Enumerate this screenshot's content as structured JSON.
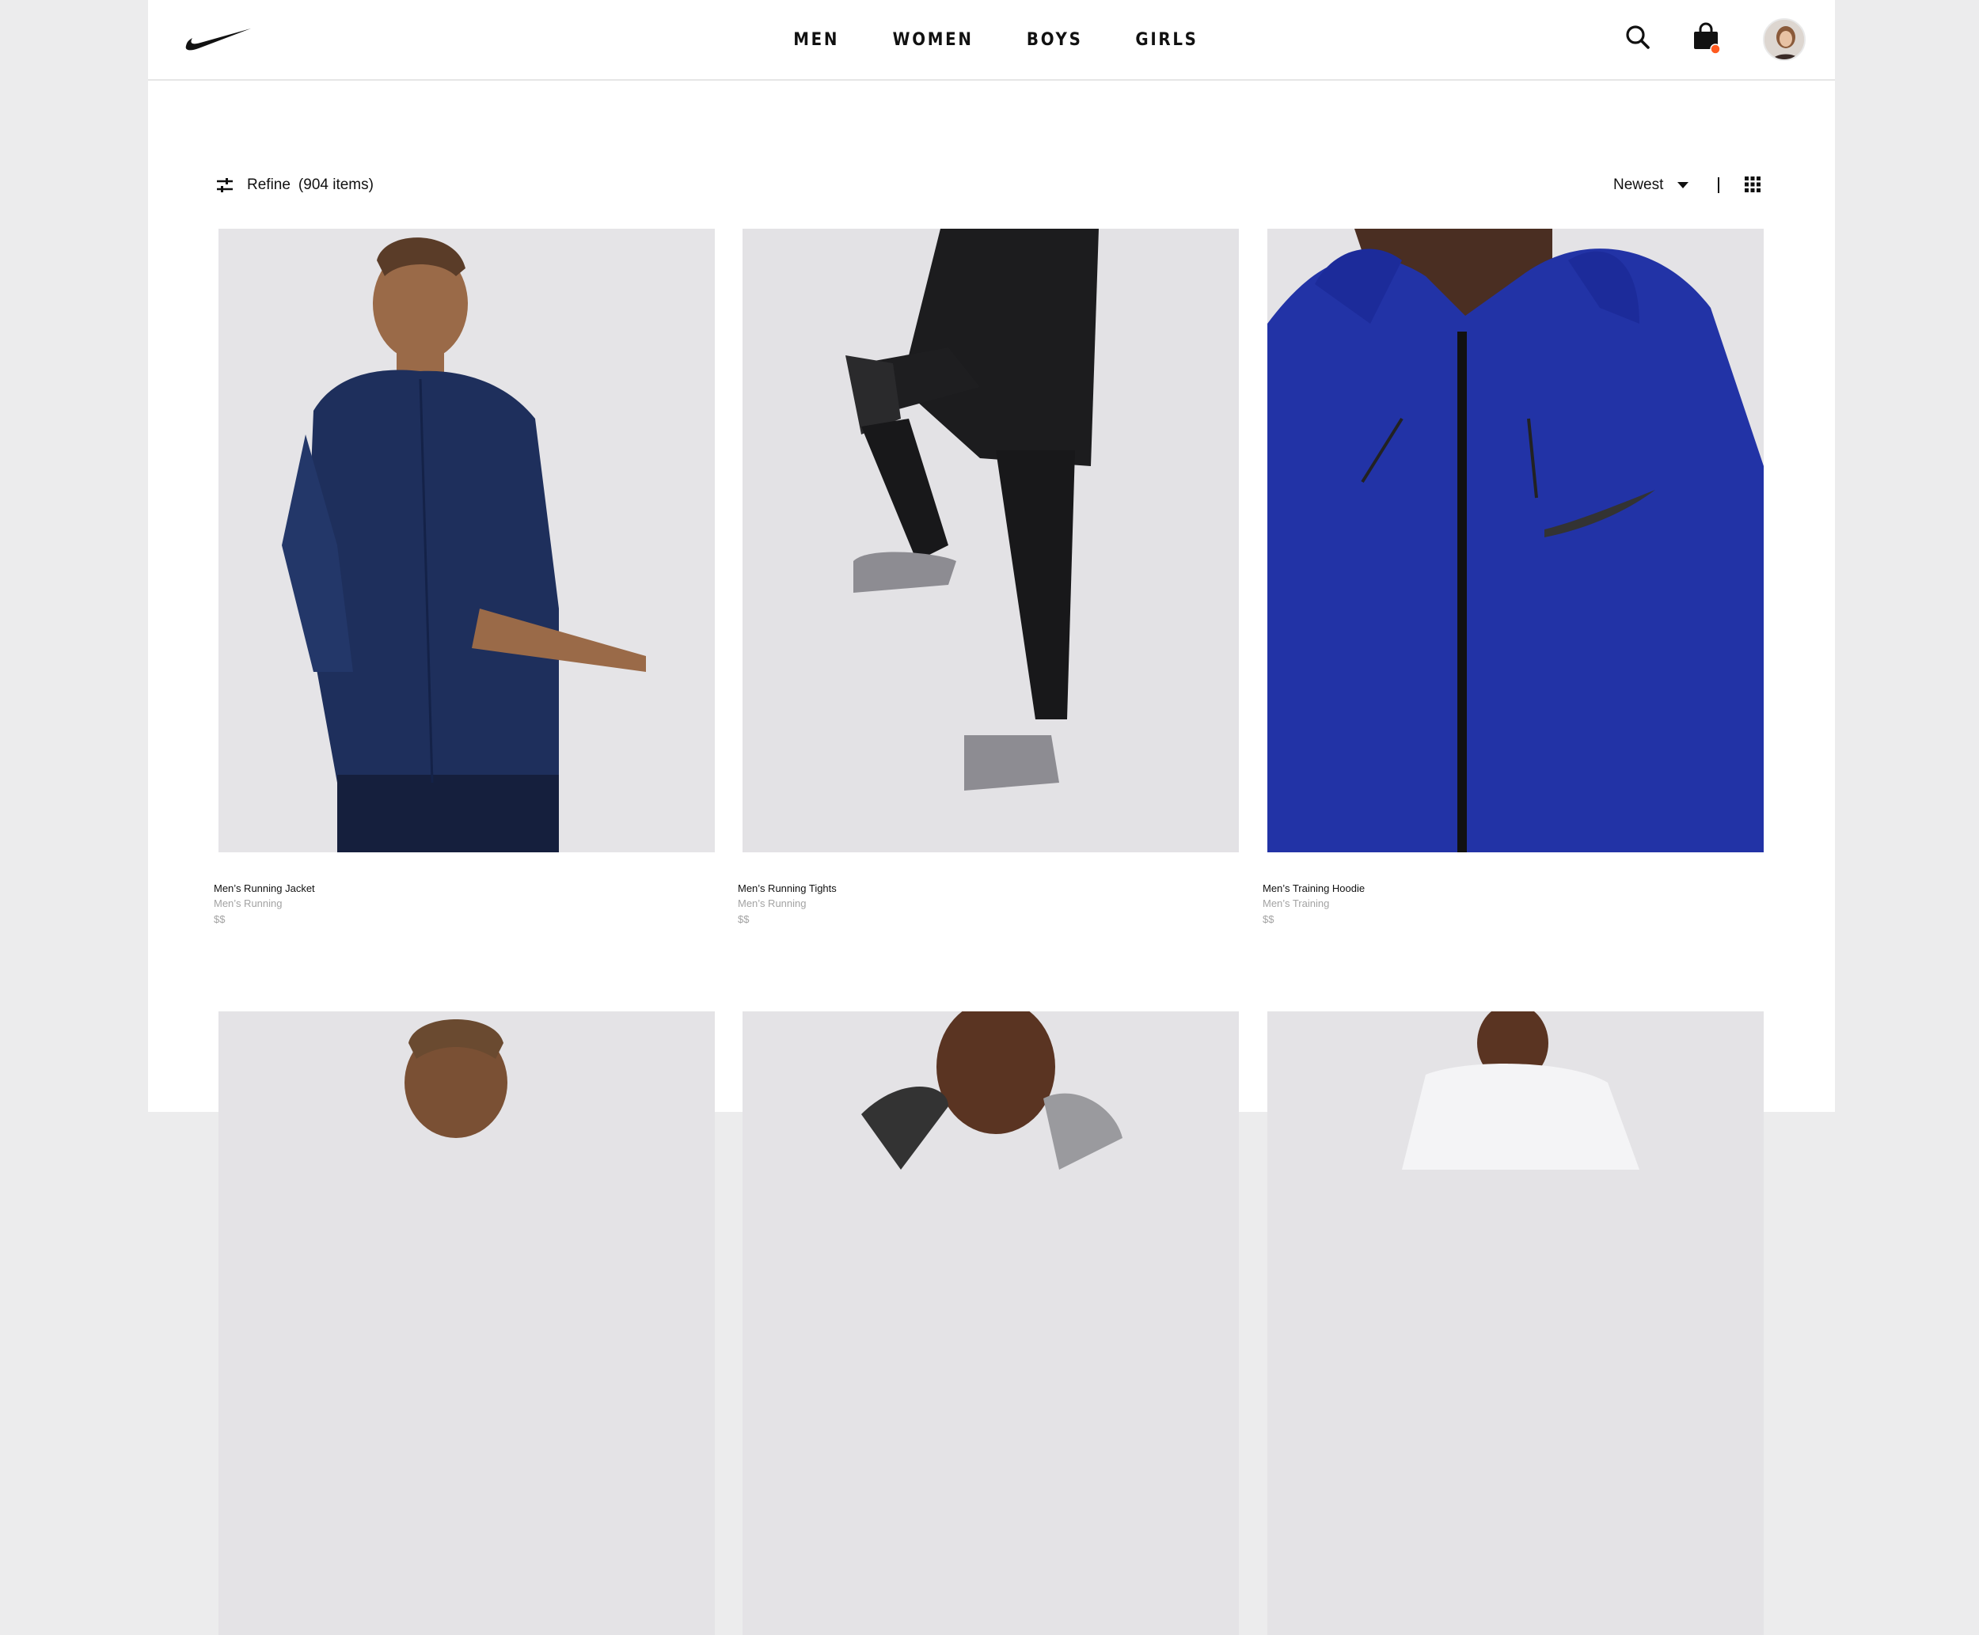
{
  "nav": {
    "items": [
      "MEN",
      "WOMEN",
      "BOYS",
      "GIRLS"
    ]
  },
  "header": {
    "logo_icon": "swoosh-logo-icon",
    "search_icon": "search-icon",
    "bag_icon": "shopping-bag-icon",
    "bag_badge_color": "#ff5a1f"
  },
  "toolbar": {
    "refine_label": "Refine",
    "item_count": "(904 items)",
    "sort_label": "Newest",
    "divider": "|"
  },
  "products": [
    {
      "name": "Men’s Running Jacket",
      "category": "Men’s Running",
      "price": "$$"
    },
    {
      "name": "Men’s Running Tights",
      "category": "Men’s Running",
      "price": "$$"
    },
    {
      "name": "Men’s Training Hoodie",
      "category": "Men’s Training",
      "price": "$$"
    },
    {
      "name": "",
      "category": "",
      "price": ""
    },
    {
      "name": "",
      "category": "",
      "price": ""
    },
    {
      "name": "",
      "category": "",
      "price": ""
    }
  ],
  "colors": {
    "page_bg": "#ffffff",
    "outer_bg": "#ececed",
    "text": "#111111",
    "muted_text": "#a3a3a3",
    "jacket": "#1e2f5c",
    "hoodie": "#2233a6"
  }
}
